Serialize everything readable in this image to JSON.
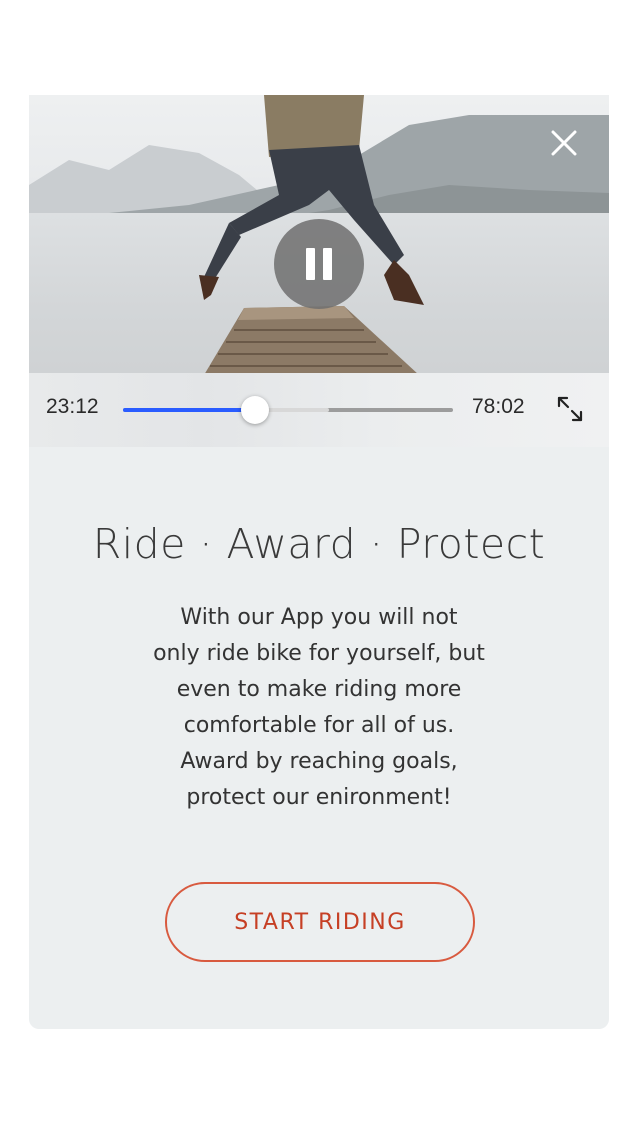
{
  "player": {
    "current_time": "23:12",
    "total_time": "78:02",
    "progress": 0.4,
    "buffered": 0.625,
    "progress_color": "#2a5cff",
    "icons": {
      "close": "close-icon",
      "pause": "pause-icon",
      "fullscreen": "expand-icon"
    }
  },
  "content": {
    "title": "Ride · Award · Protect",
    "description_lines": [
      "With our App you will not",
      "only ride bike for yourself, but",
      "even to make riding more",
      "comfortable for all of us.",
      "Award by reaching goals,",
      "protect our enironment!"
    ],
    "cta_label": "START RIDING",
    "cta_color": "#d85a3f"
  }
}
